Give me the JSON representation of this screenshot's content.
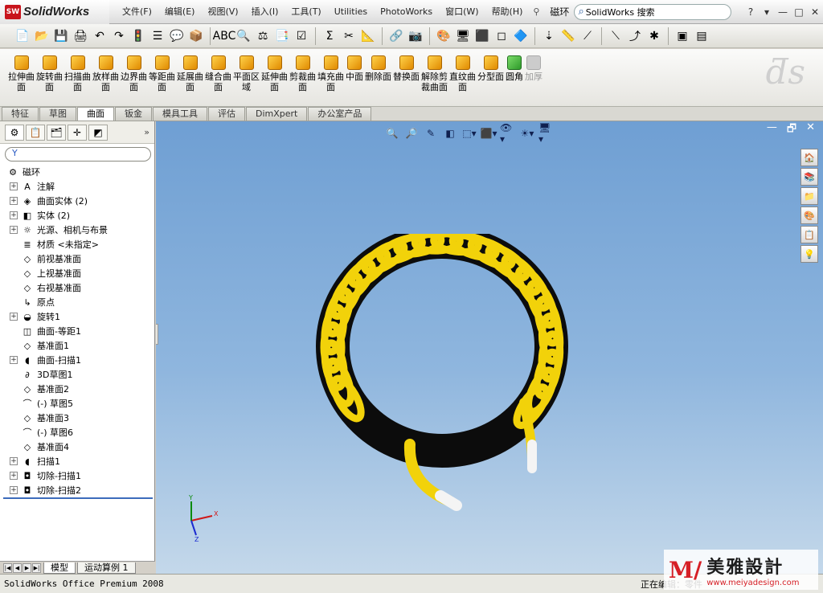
{
  "app": {
    "logo_badge": "SW",
    "logo_text": "SolidWorks",
    "document": "磁环",
    "search_placeholder": "SolidWorks 搜索"
  },
  "menu": [
    "文件(F)",
    "编辑(E)",
    "视图(V)",
    "插入(I)",
    "工具(T)",
    "Utilities",
    "PhotoWorks",
    "窗口(W)",
    "帮助(H)"
  ],
  "title_controls": [
    "?",
    "▾",
    "—",
    "□",
    "✕"
  ],
  "toolbar_standard": [
    "📄",
    "📂",
    "💾",
    "🖨",
    "↶",
    "↷",
    "🚦",
    "☰",
    "💬",
    "📦",
    "ABC",
    "🔍",
    "⚖",
    "📑",
    "☑",
    "Σ",
    "✂",
    "📐",
    "🔗",
    "📷",
    "🎨",
    "🖥",
    "⬛",
    "◻",
    "🔷",
    "⇣",
    "📏",
    "⟋",
    "⟍",
    "⤴",
    "✱",
    "▣",
    "▤"
  ],
  "command_manager": {
    "commands": [
      {
        "label": "拉伸曲\n面",
        "state": "normal"
      },
      {
        "label": "旋转曲\n面",
        "state": "normal"
      },
      {
        "label": "扫描曲\n面",
        "state": "normal"
      },
      {
        "label": "放样曲\n面",
        "state": "normal"
      },
      {
        "label": "边界曲\n面",
        "state": "normal"
      },
      {
        "label": "等距曲\n面",
        "state": "normal"
      },
      {
        "label": "延展曲\n面",
        "state": "normal"
      },
      {
        "label": "缝合曲\n面",
        "state": "normal"
      },
      {
        "label": "平面区\n域",
        "state": "normal"
      },
      {
        "label": "延伸曲\n面",
        "state": "normal"
      },
      {
        "label": "剪裁曲\n面",
        "state": "normal"
      },
      {
        "label": "填充曲\n面",
        "state": "normal"
      },
      {
        "label": "中面",
        "state": "normal"
      },
      {
        "label": "删除面",
        "state": "normal"
      },
      {
        "label": "替换面",
        "state": "normal"
      },
      {
        "label": "解除剪\n裁曲面",
        "state": "normal"
      },
      {
        "label": "直纹曲\n面",
        "state": "normal"
      },
      {
        "label": "分型面",
        "state": "normal"
      },
      {
        "label": "圆角",
        "state": "green"
      },
      {
        "label": "加厚",
        "state": "disabled"
      }
    ],
    "tabs": [
      {
        "label": "特征",
        "active": false
      },
      {
        "label": "草图",
        "active": false
      },
      {
        "label": "曲面",
        "active": true
      },
      {
        "label": "钣金",
        "active": false
      },
      {
        "label": "模具工具",
        "active": false
      },
      {
        "label": "评估",
        "active": false
      },
      {
        "label": "DimXpert",
        "active": false
      },
      {
        "label": "办公室产品",
        "active": false
      }
    ]
  },
  "pane": {
    "tabs": [
      "⚙",
      "📋",
      "🗂",
      "✛",
      "◩"
    ],
    "more": "»",
    "filter": "Y"
  },
  "tree": {
    "root": "磁环",
    "items": [
      {
        "label": "注解",
        "icon": "A",
        "expand": "+"
      },
      {
        "label": "曲面实体 (2)",
        "icon": "◈",
        "expand": "+"
      },
      {
        "label": "实体 (2)",
        "icon": "◧",
        "expand": "+"
      },
      {
        "label": "光源、相机与布景",
        "icon": "☼",
        "expand": "+"
      },
      {
        "label": "材质 <未指定>",
        "icon": "≣",
        "expand": ""
      },
      {
        "label": "前视基准面",
        "icon": "◇",
        "expand": ""
      },
      {
        "label": "上视基准面",
        "icon": "◇",
        "expand": ""
      },
      {
        "label": "右视基准面",
        "icon": "◇",
        "expand": ""
      },
      {
        "label": "原点",
        "icon": "↳",
        "expand": ""
      },
      {
        "label": "旋转1",
        "icon": "◒",
        "expand": "+"
      },
      {
        "label": "曲面-等距1",
        "icon": "◫",
        "expand": ""
      },
      {
        "label": "基准面1",
        "icon": "◇",
        "expand": ""
      },
      {
        "label": "曲面-扫描1",
        "icon": "◖",
        "expand": "+"
      },
      {
        "label": "3D草图1",
        "icon": "∂",
        "expand": ""
      },
      {
        "label": "基准面2",
        "icon": "◇",
        "expand": ""
      },
      {
        "label": "(-) 草图5",
        "icon": "⌒",
        "expand": ""
      },
      {
        "label": "基准面3",
        "icon": "◇",
        "expand": ""
      },
      {
        "label": "(-) 草图6",
        "icon": "⌒",
        "expand": ""
      },
      {
        "label": "基准面4",
        "icon": "◇",
        "expand": ""
      },
      {
        "label": "扫描1",
        "icon": "◖",
        "expand": "+"
      },
      {
        "label": "切除-扫描1",
        "icon": "◘",
        "expand": "+"
      },
      {
        "label": "切除-扫描2",
        "icon": "◘",
        "expand": "+"
      }
    ]
  },
  "bottom_tabs": {
    "nav": [
      "|◀",
      "◀",
      "▶",
      "▶|"
    ],
    "tabs": [
      {
        "label": "模型",
        "active": true
      },
      {
        "label": "运动算例 1",
        "active": false
      }
    ]
  },
  "viewport": {
    "window_controls": [
      "—",
      "🗗",
      "✕"
    ],
    "headsup": [
      "🔍",
      "🔎",
      "✎",
      "◧",
      "⬚▾",
      "⬛▾",
      "👁▾",
      "☀▾",
      "🖥▾"
    ],
    "task_pane": [
      "🏠",
      "📚",
      "📁",
      "🎨",
      "📋",
      "💡"
    ],
    "triad": {
      "x": "X",
      "y": "Y",
      "z": "Z"
    },
    "colors": {
      "coil": "#f2d20a",
      "core": "#0c0c0c",
      "wire_end": "#f4f4f4"
    }
  },
  "status": {
    "product": "SolidWorks Office Premium 2008",
    "editing": "正在编辑：零件"
  },
  "watermark": {
    "mark": "M/",
    "chinese": "美雅設計",
    "url": "www.meiyadesign.com"
  }
}
